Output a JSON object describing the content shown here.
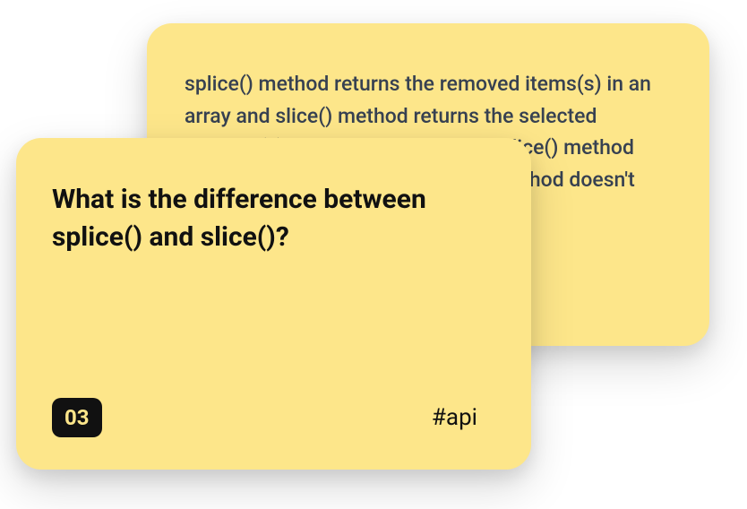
{
  "back_card": {
    "answer_text": "splice() method returns the removed items(s) in an array and slice() method returns the selected element(s) in a new array object. splice() method changes the original array, slice() method doesn't change the original array."
  },
  "front_card": {
    "question": "What is the difference between splice() and slice()?",
    "number": "03",
    "tag": "#api"
  }
}
